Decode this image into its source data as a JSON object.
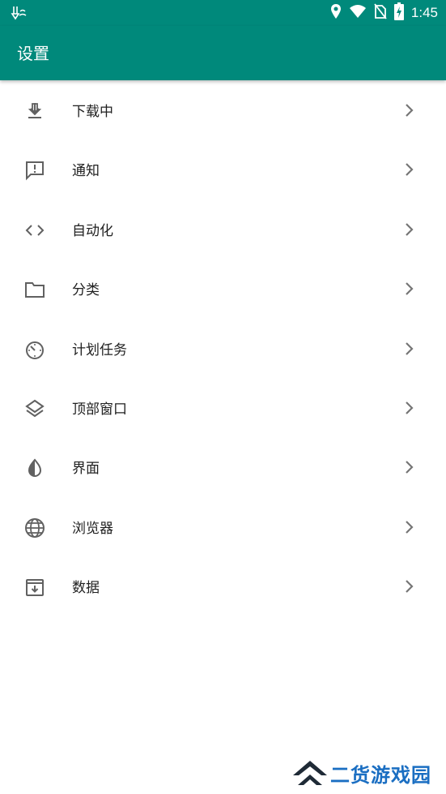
{
  "status_bar": {
    "time": "1:45",
    "icons": [
      "debug-icon",
      "location-icon",
      "wifi-icon",
      "no-sim-icon",
      "battery-charging-icon"
    ]
  },
  "toolbar": {
    "title": "设置"
  },
  "settings": [
    {
      "label": "下载中",
      "icon": "download-icon"
    },
    {
      "label": "通知",
      "icon": "notification-icon"
    },
    {
      "label": "自动化",
      "icon": "code-icon"
    },
    {
      "label": "分类",
      "icon": "folder-icon"
    },
    {
      "label": "计划任务",
      "icon": "timer-icon"
    },
    {
      "label": "顶部窗口",
      "icon": "layers-icon"
    },
    {
      "label": "界面",
      "icon": "contrast-icon"
    },
    {
      "label": "浏览器",
      "icon": "globe-icon"
    },
    {
      "label": "数据",
      "icon": "archive-icon"
    }
  ],
  "watermark": {
    "text": "二货游戏园"
  },
  "colors": {
    "primary": "#00897b",
    "icon": "#616161",
    "text": "#212121",
    "watermark": "#1a6ec2"
  }
}
